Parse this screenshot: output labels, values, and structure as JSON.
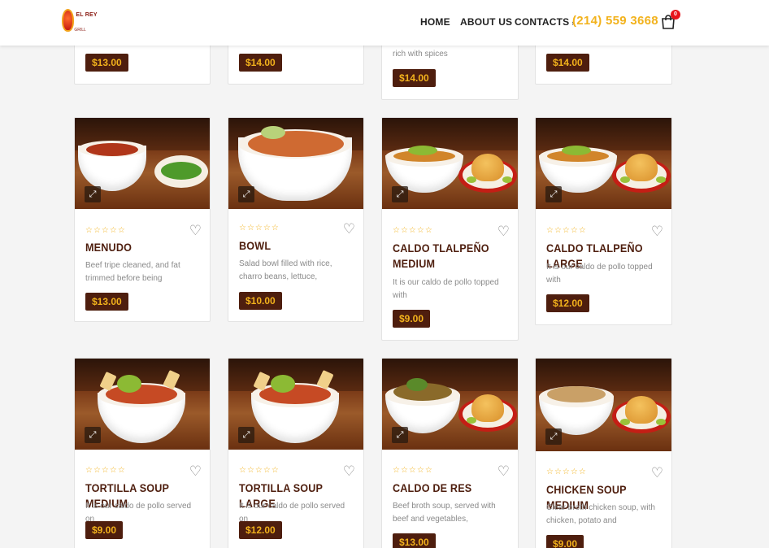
{
  "header": {
    "logo_text": "EL REY",
    "logo_sub": "GRILL",
    "nav": {
      "home": "HOME",
      "about": "ABOUT US",
      "contacts": "CONTACTS"
    },
    "phone": "(214) 559 3668",
    "cart_count": "0"
  },
  "top_row": {
    "prices": [
      "$13.00",
      "$14.00",
      "$14.00",
      "$14.00"
    ],
    "desc_3": "rich with spices"
  },
  "row2": [
    {
      "title": "MENUDO",
      "desc": "Beef tripe cleaned, and fat trimmed before being",
      "price": "$13.00"
    },
    {
      "title": "BOWL",
      "desc": "Salad bowl filled with rice, charro beans, lettuce,",
      "price": "$10.00"
    },
    {
      "title": "CALDO TLALPEÑO MEDIUM",
      "desc": "It is our caldo de pollo topped with",
      "price": "$9.00"
    },
    {
      "title": "CALDO TLALPEÑO LARGE",
      "desc": "It is our caldo de pollo topped with",
      "price": "$12.00"
    }
  ],
  "row3": [
    {
      "title": "TORTILLA SOUP MEDIUM",
      "desc": "It is our caldo de pollo served on",
      "price": "$9.00"
    },
    {
      "title": "TORTILLA SOUP LARGE",
      "desc": "It is our caldo de pollo served on",
      "price": "$12.00"
    },
    {
      "title": "CALDO DE RES",
      "desc": "Beef broth soup, served with beef and vegetables,",
      "price": "$13.00"
    },
    {
      "title": "CHICKEN SOUP MEDIUM",
      "desc": "Clear broth chicken soup, with chicken, potato and",
      "price": "$9.00"
    }
  ],
  "icons": {
    "stars": "☆☆☆☆☆",
    "heart": "♡",
    "zoom": "⤢"
  },
  "colors": {
    "accent": "#f2b21c",
    "brand_dark": "#4e1e0e",
    "badge": "#e8141c"
  }
}
